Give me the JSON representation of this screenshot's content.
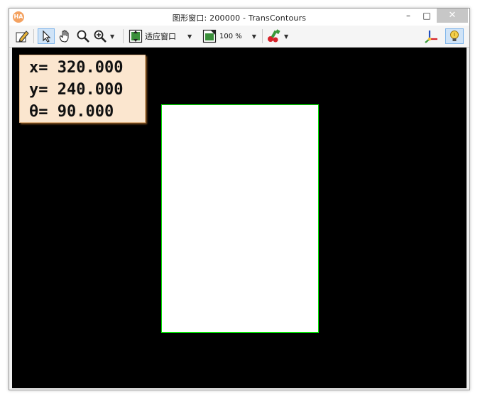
{
  "window": {
    "title": "图形窗口: 200000 - TransContours",
    "app_icon_text": "HA",
    "minimize_glyph": "–",
    "maximize_glyph": "□",
    "close_glyph": "✕"
  },
  "toolbar": {
    "fit_window_label": "适应窗口",
    "zoom_label": "100 %",
    "icons": [
      "edit-icon",
      "pointer-icon",
      "hand-pan-icon",
      "magnifier-icon",
      "zoom-in-icon",
      "fit-window-icon",
      "zoom-percent-icon",
      "paint-icon",
      "coordinate-axes-icon",
      "lightbulb-icon"
    ]
  },
  "canvas": {
    "background": "#000000",
    "shape_fill": "#ffffff",
    "shape_stroke": "#00e000"
  },
  "info_box": {
    "x_line": "x= 320.000",
    "y_line": "y= 240.000",
    "theta_line": "θ= 90.000",
    "background": "#fbe6cf"
  }
}
